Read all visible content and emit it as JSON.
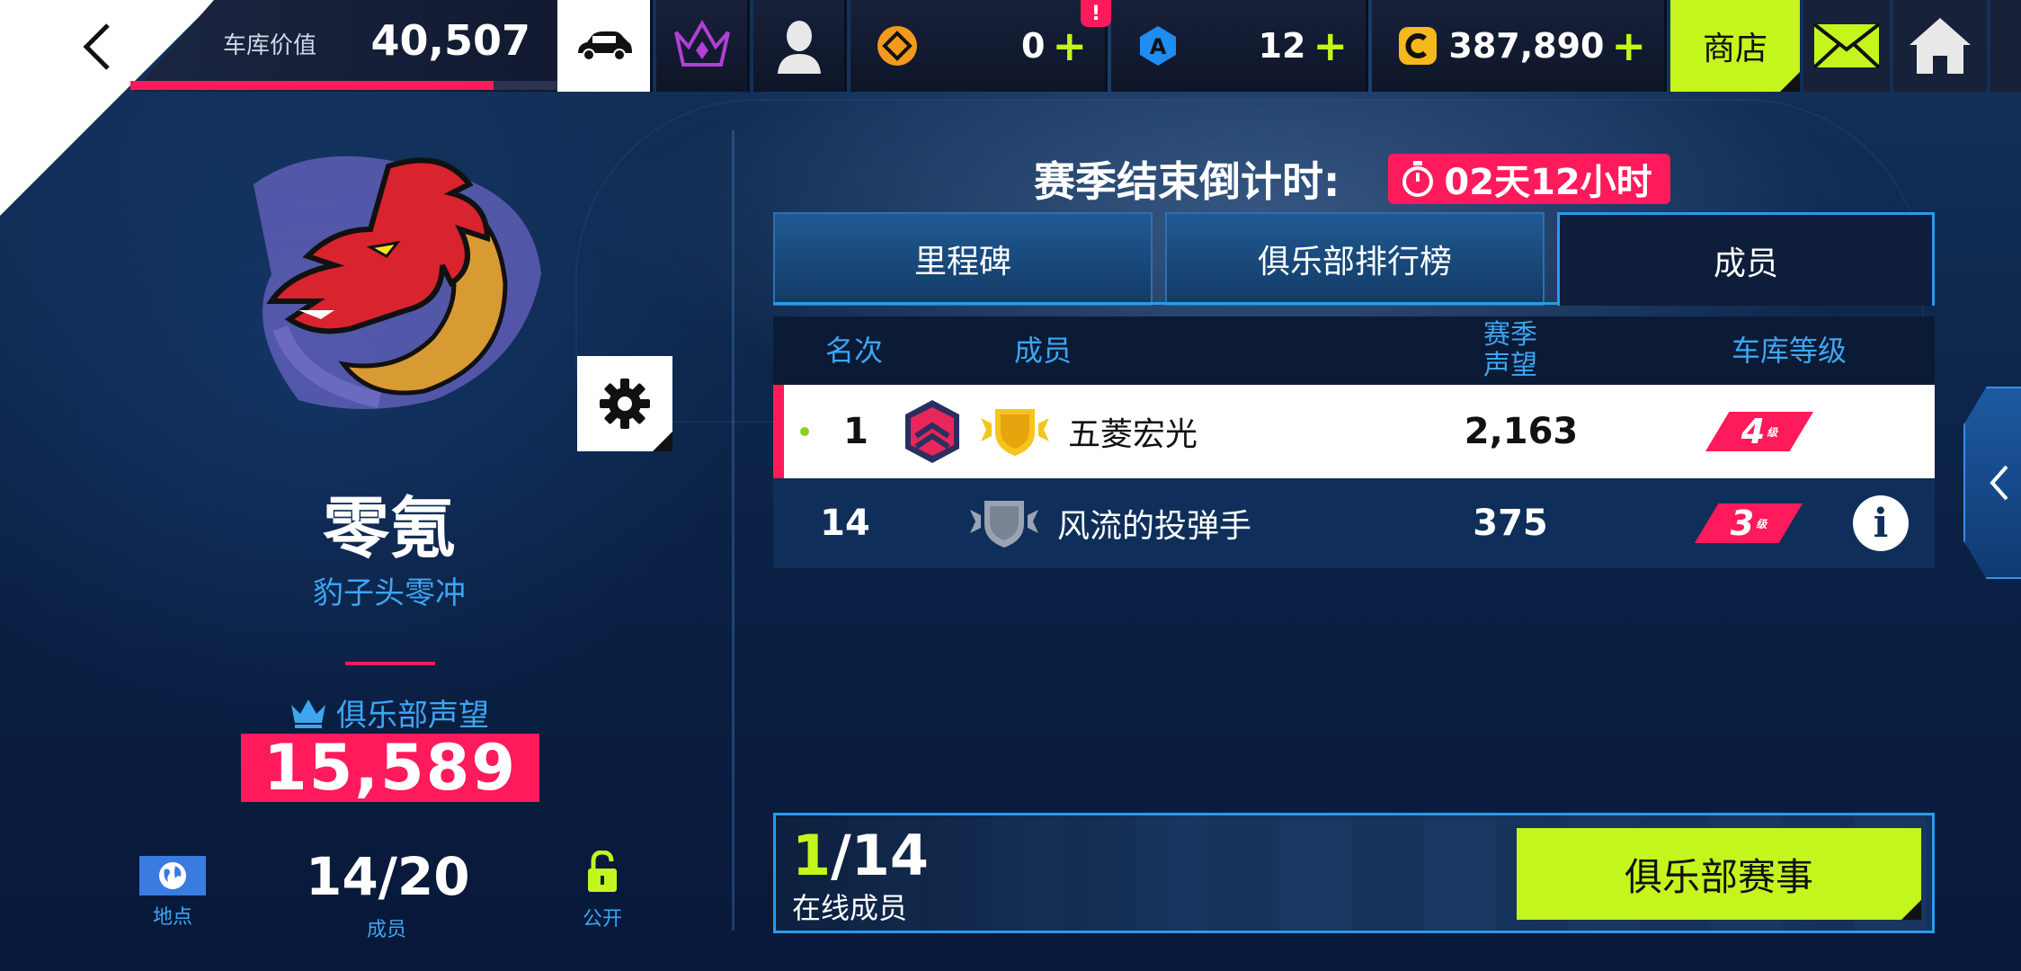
{
  "topbar": {
    "garage_value_label": "车库价值",
    "garage_value": "40,507",
    "garage_progress": 0.85,
    "alert_mark": "!",
    "res1_value": "0",
    "res2_value": "12",
    "res3_value": "387,890",
    "plus": "+",
    "shop_label": "商店",
    "icons": [
      "back-icon",
      "car-icon",
      "crown-icon",
      "avatar-icon",
      "token-icon",
      "blueprint-icon",
      "credits-icon",
      "mail-icon",
      "home-icon"
    ]
  },
  "club": {
    "name": "零氪",
    "subtitle": "豹子头零冲",
    "rep_label": "俱乐部声望",
    "rep_value": "15,589",
    "location_label": "地点",
    "members_value": "14/20",
    "members_label": "成员",
    "public_label": "公开"
  },
  "season": {
    "countdown_label": "赛季结束倒计时:",
    "countdown_value": "02天12小时"
  },
  "tabs": [
    {
      "label": "里程碑",
      "active": false
    },
    {
      "label": "俱乐部排行榜",
      "active": false
    },
    {
      "label": "成员",
      "active": true
    }
  ],
  "table": {
    "headers": {
      "rank": "名次",
      "member": "成员",
      "season_rep_line1": "赛季",
      "season_rep_line2": "声望",
      "garage_level": "车库等级"
    },
    "rows": [
      {
        "rank": "1",
        "name": "五菱宏光",
        "season_rep": "2,163",
        "garage_level": "4",
        "level_suffix": "级",
        "online": true,
        "highlight": true
      },
      {
        "rank": "14",
        "name": "风流的投弹手",
        "season_rep": "375",
        "garage_level": "3",
        "level_suffix": "级",
        "online": false,
        "highlight": false
      }
    ],
    "info_glyph": "i"
  },
  "footer": {
    "online_current": "1",
    "online_total": "/14",
    "online_label": "在线成员",
    "event_button": "俱乐部赛事"
  },
  "colors": {
    "accent_pink": "#ff1a5b",
    "accent_lime": "#c4f51d",
    "accent_blue": "#3da6f2",
    "bg_dark": "#0a1e3d"
  }
}
